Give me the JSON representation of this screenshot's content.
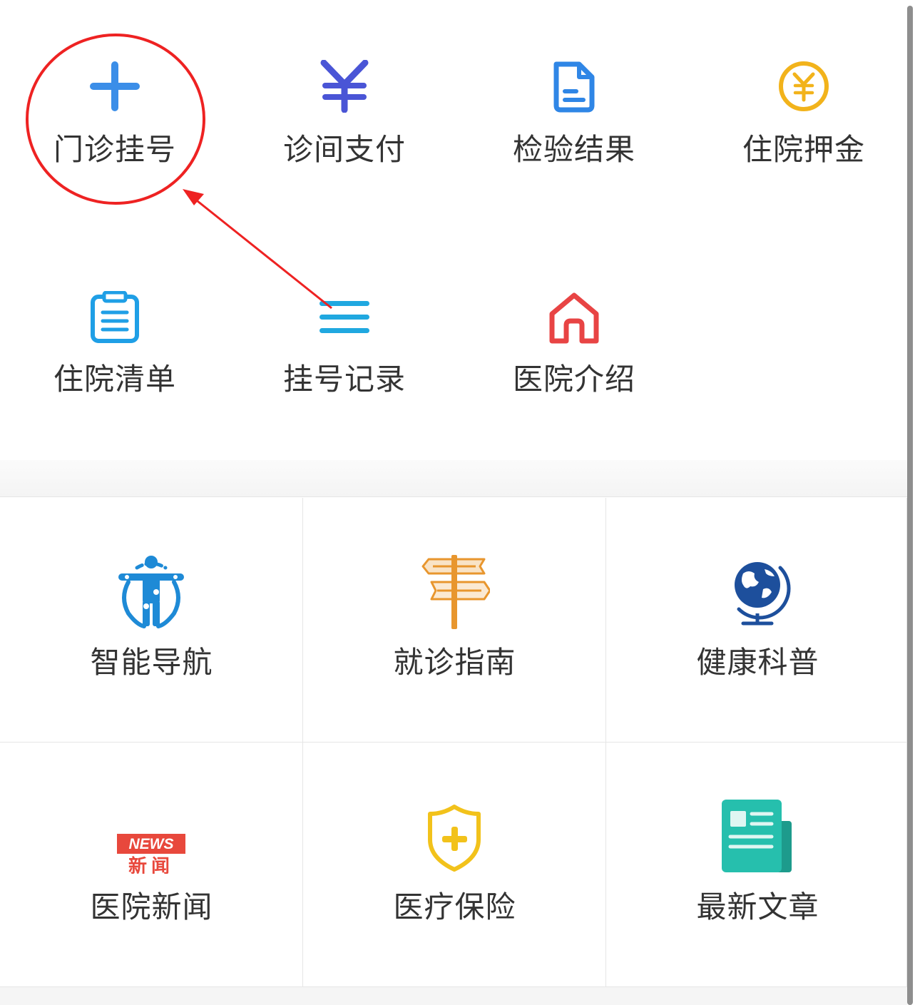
{
  "quick_menu": {
    "items": [
      {
        "label": "门诊挂号",
        "icon": "plus-icon",
        "color": "#3b8ee8"
      },
      {
        "label": "诊间支付",
        "icon": "yuan-icon",
        "color": "#4a55d6"
      },
      {
        "label": "检验结果",
        "icon": "document-icon",
        "color": "#2f86e6"
      },
      {
        "label": "住院押金",
        "icon": "yuan-coin-icon",
        "color": "#f2b31b"
      },
      {
        "label": "住院清单",
        "icon": "clipboard-icon",
        "color": "#1f9fe6"
      },
      {
        "label": "挂号记录",
        "icon": "menu-lines-icon",
        "color": "#20a8e0"
      },
      {
        "label": "医院介绍",
        "icon": "home-icon",
        "color": "#e84444"
      }
    ]
  },
  "service_grid": {
    "items": [
      {
        "label": "智能导航",
        "icon": "body-navigation-icon",
        "color": "#1e8ad6"
      },
      {
        "label": "就诊指南",
        "icon": "signpost-icon",
        "color": "#e8962e"
      },
      {
        "label": "健康科普",
        "icon": "globe-icon",
        "color": "#1d4f9c"
      },
      {
        "label": "医院新闻",
        "icon": "news-icon",
        "color": "#e8483c",
        "badge_text": "NEWS",
        "badge_sub": "新闻"
      },
      {
        "label": "医疗保险",
        "icon": "shield-plus-icon",
        "color": "#f2c21b"
      },
      {
        "label": "最新文章",
        "icon": "newspaper-icon",
        "color": "#26bfad"
      }
    ]
  },
  "annotation_color": "#ee2222"
}
